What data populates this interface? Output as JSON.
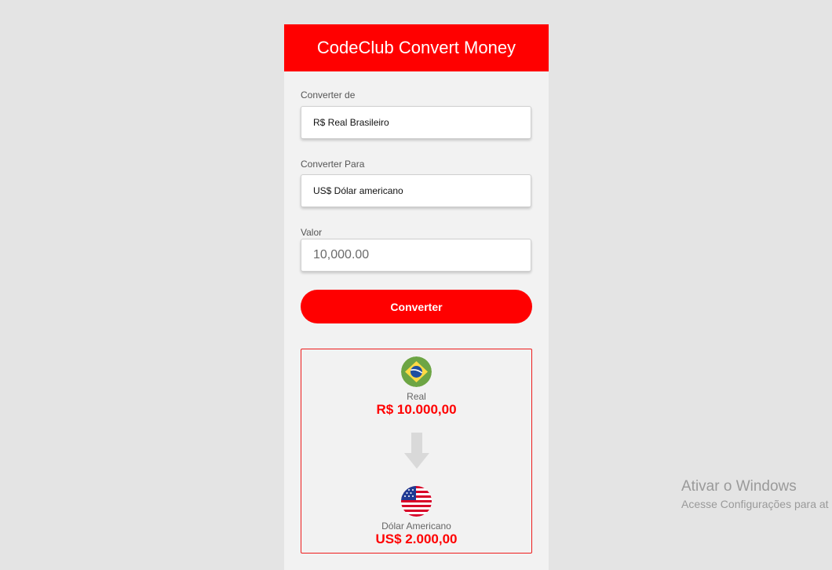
{
  "app": {
    "title": "CodeClub Convert Money",
    "accent_color": "#ff0000"
  },
  "form": {
    "from_label": "Converter de",
    "from_value": "R$ Real Brasileiro",
    "to_label": "Converter Para",
    "to_value": "US$ Dólar americano",
    "amount_label": "Valor",
    "amount_placeholder": "10,000.00",
    "convert_button": "Converter"
  },
  "result": {
    "from_flag_icon": "brazil-flag-icon",
    "from_currency_name": "Real",
    "from_amount": "R$ 10.000,00",
    "arrow_icon": "arrow-down-icon",
    "to_flag_icon": "usa-flag-icon",
    "to_currency_name": "Dólar Americano",
    "to_amount": "US$ 2.000,00"
  },
  "watermark": {
    "title": "Ativar o Windows",
    "subtitle": "Acesse Configurações para at"
  }
}
